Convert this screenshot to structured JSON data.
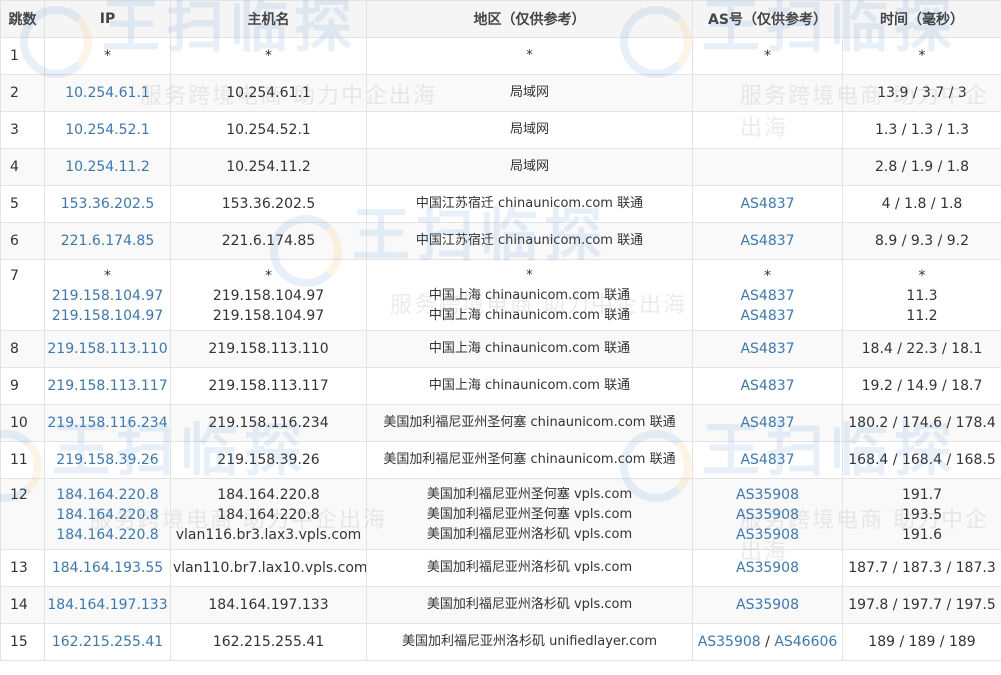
{
  "headers": [
    "跳数",
    "IP",
    "主机名",
    "地区（仅供参考）",
    "AS号（仅供参考）",
    "时间（毫秒）"
  ],
  "watermark": {
    "brand": "王扫临探",
    "slogan": "服务跨境电商 助力中企出海"
  },
  "rows": [
    {
      "hop": "1",
      "ips": [
        "*"
      ],
      "hosts": [
        "*"
      ],
      "regions": [
        "*"
      ],
      "as": [
        [
          "*"
        ]
      ],
      "times": [
        "*"
      ]
    },
    {
      "hop": "2",
      "ips": [
        "10.254.61.1"
      ],
      "hosts": [
        "10.254.61.1"
      ],
      "regions": [
        "局域网"
      ],
      "as": [
        []
      ],
      "times": [
        "13.9 / 3.7 / 3"
      ]
    },
    {
      "hop": "3",
      "ips": [
        "10.254.52.1"
      ],
      "hosts": [
        "10.254.52.1"
      ],
      "regions": [
        "局域网"
      ],
      "as": [
        []
      ],
      "times": [
        "1.3 / 1.3 / 1.3"
      ]
    },
    {
      "hop": "4",
      "ips": [
        "10.254.11.2"
      ],
      "hosts": [
        "10.254.11.2"
      ],
      "regions": [
        "局域网"
      ],
      "as": [
        []
      ],
      "times": [
        "2.8 / 1.9 / 1.8"
      ]
    },
    {
      "hop": "5",
      "ips": [
        "153.36.202.5"
      ],
      "hosts": [
        "153.36.202.5"
      ],
      "regions": [
        "中国江苏宿迁 chinaunicom.com 联通"
      ],
      "as": [
        [
          "AS4837"
        ]
      ],
      "times": [
        "4 / 1.8 / 1.8"
      ]
    },
    {
      "hop": "6",
      "ips": [
        "221.6.174.85"
      ],
      "hosts": [
        "221.6.174.85"
      ],
      "regions": [
        "中国江苏宿迁 chinaunicom.com 联通"
      ],
      "as": [
        [
          "AS4837"
        ]
      ],
      "times": [
        "8.9 / 9.3 / 9.2"
      ]
    },
    {
      "hop": "7",
      "ips": [
        "*",
        "219.158.104.97",
        "219.158.104.97"
      ],
      "hosts": [
        "*",
        "219.158.104.97",
        "219.158.104.97"
      ],
      "regions": [
        "*",
        "中国上海 chinaunicom.com 联通",
        "中国上海 chinaunicom.com 联通"
      ],
      "as": [
        [
          "*"
        ],
        [
          "AS4837"
        ],
        [
          "AS4837"
        ]
      ],
      "times": [
        "*",
        "11.3",
        "11.2"
      ]
    },
    {
      "hop": "8",
      "ips": [
        "219.158.113.110"
      ],
      "hosts": [
        "219.158.113.110"
      ],
      "regions": [
        "中国上海 chinaunicom.com 联通"
      ],
      "as": [
        [
          "AS4837"
        ]
      ],
      "times": [
        "18.4 / 22.3 / 18.1"
      ]
    },
    {
      "hop": "9",
      "ips": [
        "219.158.113.117"
      ],
      "hosts": [
        "219.158.113.117"
      ],
      "regions": [
        "中国上海 chinaunicom.com 联通"
      ],
      "as": [
        [
          "AS4837"
        ]
      ],
      "times": [
        "19.2 / 14.9 / 18.7"
      ]
    },
    {
      "hop": "10",
      "ips": [
        "219.158.116.234"
      ],
      "hosts": [
        "219.158.116.234"
      ],
      "regions": [
        "美国加利福尼亚州圣何塞 chinaunicom.com 联通"
      ],
      "as": [
        [
          "AS4837"
        ]
      ],
      "times": [
        "180.2 / 174.6 / 178.4"
      ]
    },
    {
      "hop": "11",
      "ips": [
        "219.158.39.26"
      ],
      "hosts": [
        "219.158.39.26"
      ],
      "regions": [
        "美国加利福尼亚州圣何塞 chinaunicom.com 联通"
      ],
      "as": [
        [
          "AS4837"
        ]
      ],
      "times": [
        "168.4 / 168.4 / 168.5"
      ]
    },
    {
      "hop": "12",
      "ips": [
        "184.164.220.8",
        "184.164.220.8",
        "184.164.220.8"
      ],
      "hosts": [
        "184.164.220.8",
        "184.164.220.8",
        "vlan116.br3.lax3.vpls.com"
      ],
      "regions": [
        "美国加利福尼亚州圣何塞 vpls.com",
        "美国加利福尼亚州圣何塞 vpls.com",
        "美国加利福尼亚州洛杉矶 vpls.com"
      ],
      "as": [
        [
          "AS35908"
        ],
        [
          "AS35908"
        ],
        [
          "AS35908"
        ]
      ],
      "times": [
        "191.7",
        "193.5",
        "191.6"
      ]
    },
    {
      "hop": "13",
      "ips": [
        "184.164.193.55"
      ],
      "hosts": [
        "vlan110.br7.lax10.vpls.com"
      ],
      "regions": [
        "美国加利福尼亚州洛杉矶 vpls.com"
      ],
      "as": [
        [
          "AS35908"
        ]
      ],
      "times": [
        "187.7 / 187.3 / 187.3"
      ]
    },
    {
      "hop": "14",
      "ips": [
        "184.164.197.133"
      ],
      "hosts": [
        "184.164.197.133"
      ],
      "regions": [
        "美国加利福尼亚州洛杉矶 vpls.com"
      ],
      "as": [
        [
          "AS35908"
        ]
      ],
      "times": [
        "197.8 / 197.7 / 197.5"
      ]
    },
    {
      "hop": "15",
      "ips": [
        "162.215.255.41"
      ],
      "hosts": [
        "162.215.255.41"
      ],
      "regions": [
        "美国加利福尼亚州洛杉矶 unifiedlayer.com"
      ],
      "as": [
        [
          "AS35908",
          "AS46606"
        ]
      ],
      "times": [
        "189 / 189 / 189"
      ]
    }
  ]
}
